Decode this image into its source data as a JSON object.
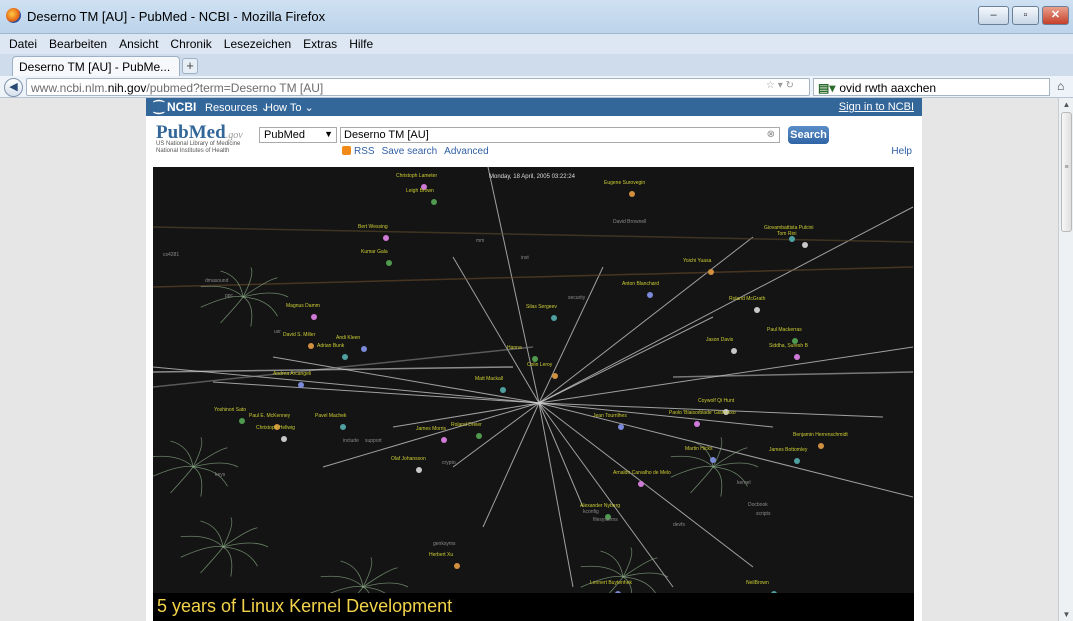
{
  "window": {
    "title": "Deserno TM [AU] - PubMed - NCBI - Mozilla Firefox"
  },
  "menu": [
    "Datei",
    "Bearbeiten",
    "Ansicht",
    "Chronik",
    "Lesezeichen",
    "Extras",
    "Hilfe"
  ],
  "tab": {
    "label": "Deserno TM [AU] - PubMe...",
    "new_tab": "+"
  },
  "address": {
    "prefix": "www.ncbi.nlm.",
    "host": "nih.gov",
    "path": "/pubmed?term=Deserno TM [AU]"
  },
  "search_bar": {
    "value": "ovid rwth aaxchen"
  },
  "ncbi": {
    "logo": "NCBI",
    "resources": "Resources",
    "how_to": "How To",
    "sign_in": "Sign in to NCBI",
    "pubmed_logo": "PubMed",
    "pubmed_gov": ".gov",
    "sub_line1": "US National Library of Medicine",
    "sub_line2": "National Institutes of Health",
    "database": "PubMed",
    "term": "Deserno TM [AU]",
    "search_button": "Search",
    "rss": "RSS",
    "save_search": "Save search",
    "advanced": "Advanced",
    "help": "Help"
  },
  "video": {
    "date": "Monday, 18 April, 2005 03:22:24",
    "caption": "5 years of Linux Kernel Development",
    "names": [
      {
        "t": "Christoph Lameter"
      },
      {
        "t": "Leigh Brown"
      },
      {
        "t": "Eugene Surovegin"
      },
      {
        "t": "David Brownell",
        "g": 1
      },
      {
        "t": "Giovambattista Pulcini"
      },
      {
        "t": "Tom Rini"
      },
      {
        "t": "Bert Wessing"
      },
      {
        "t": "Kumar Gala"
      },
      {
        "t": "Yoichi Yuasa"
      },
      {
        "t": "Anton Blanchard"
      },
      {
        "t": "Silas Sergeev"
      },
      {
        "t": "Roland McGrath"
      },
      {
        "t": "Magnus Damm"
      },
      {
        "t": "Paul Mackerras"
      },
      {
        "t": "David S. Miller"
      },
      {
        "t": "Andi Kleen"
      },
      {
        "t": "Adrian Bunk"
      },
      {
        "t": "Jason Davis"
      },
      {
        "t": "Siddha, Suresh B"
      },
      {
        "t": "Hanna"
      },
      {
        "t": "Colin Leroy"
      },
      {
        "t": "Andrea Arcangeli"
      },
      {
        "t": "Matt Mackall"
      },
      {
        "t": "Coywolf Qi Hunt"
      },
      {
        "t": "Paolo 'Blaisorblade' Giarrusso"
      },
      {
        "t": "Yoshinori Sato"
      },
      {
        "t": "Paul E. McKenney"
      },
      {
        "t": "Jean Tourrilhes"
      },
      {
        "t": "Pavel Machek"
      },
      {
        "t": "Christoph Hellwig"
      },
      {
        "t": "James Morris"
      },
      {
        "t": "Roland Dreier"
      },
      {
        "t": "Benjamin Herrenschmidt"
      },
      {
        "t": "Martin Hicks"
      },
      {
        "t": "James Bottomley"
      },
      {
        "t": "Olaf Johansson"
      },
      {
        "t": "Arnaldo Carvalho de Melo"
      },
      {
        "t": "Alexander Nyberg"
      },
      {
        "t": "Herbert Xu"
      },
      {
        "t": "Lennert Buytenhek"
      },
      {
        "t": "NeilBrown"
      },
      {
        "t": "cs4281",
        "g": 1
      },
      {
        "t": "dmasound",
        "g": 1
      },
      {
        "t": "ppc",
        "g": 1
      },
      {
        "t": "usr",
        "g": 1
      },
      {
        "t": "mm",
        "g": 1
      },
      {
        "t": "inst",
        "g": 1
      },
      {
        "t": "security",
        "g": 1
      },
      {
        "t": "keys",
        "g": 1
      },
      {
        "t": "include",
        "g": 1
      },
      {
        "t": "support",
        "g": 1
      },
      {
        "t": "crypto",
        "g": 1
      },
      {
        "t": "filesystems",
        "g": 1
      },
      {
        "t": "devfs",
        "g": 1
      },
      {
        "t": "Docbook",
        "g": 1
      },
      {
        "t": "kernel",
        "g": 1
      },
      {
        "t": "scripts",
        "g": 1
      },
      {
        "t": "kconfig",
        "g": 1
      },
      {
        "t": "genksyms",
        "g": 1
      }
    ]
  },
  "icons": {
    "scroll_up": "▲",
    "scroll_down": "▼",
    "back": "◀",
    "home": "⌂",
    "search": "⚲"
  }
}
